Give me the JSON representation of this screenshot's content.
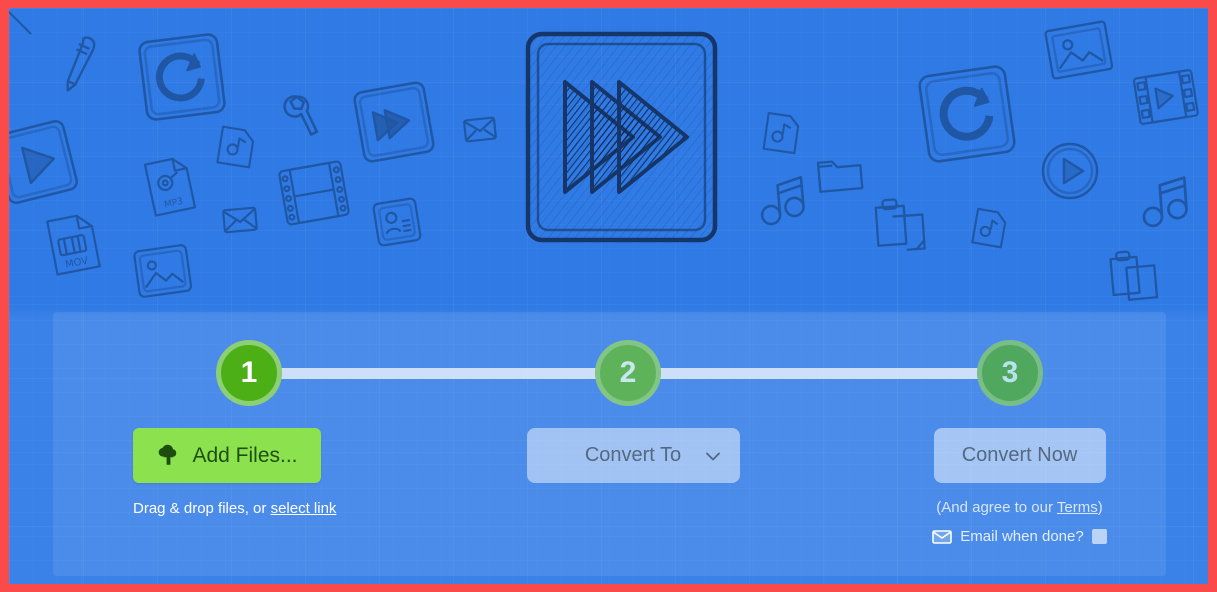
{
  "theme": {
    "frame_color": "#fb4a4a",
    "canvas_color": "#2f7ae5",
    "panel_tint": "rgba(255,255,255,0.085)",
    "add_files_green": "#8ce14f",
    "step_active_green": "#4caf15",
    "step_inactive_green": "#5eb35a",
    "muted_control": "rgba(255,255,255,0.48)"
  },
  "illustration": {
    "hero_icon": "fast-forward-media-icon",
    "scattered_icons": [
      "pencil-icon",
      "refresh-square-icon",
      "play-square-icon",
      "mov-file-icon",
      "image-square-icon",
      "wrench-icon",
      "fast-forward-square-icon",
      "film-strip-icon",
      "mp3-file-icon",
      "contact-card-icon",
      "envelope-icon",
      "music-file-icon",
      "photo-frame-icon",
      "sync-square-icon",
      "film-reel-icon",
      "play-circle-icon",
      "music-note-icon",
      "folder-icon",
      "copy-documents-icon",
      "clipboard-icon",
      "envelope-small-icon"
    ]
  },
  "stepper": {
    "steps": [
      {
        "number": "1",
        "state": "active"
      },
      {
        "number": "2",
        "state": "pending"
      },
      {
        "number": "3",
        "state": "pending"
      }
    ]
  },
  "actions": {
    "add_files": {
      "label": "Add Files...",
      "icon": "cloud-upload-icon",
      "hint_prefix": "Drag & drop files, or ",
      "hint_link": "select link"
    },
    "convert_to": {
      "label": "Convert To",
      "chevron": "chevron-down-icon"
    },
    "convert_now": {
      "label": "Convert Now",
      "terms_prefix": "(And agree to our ",
      "terms_link": "Terms",
      "terms_suffix": ")",
      "email_icon": "envelope-icon",
      "email_label": "Email when done?",
      "email_checked": false
    }
  }
}
